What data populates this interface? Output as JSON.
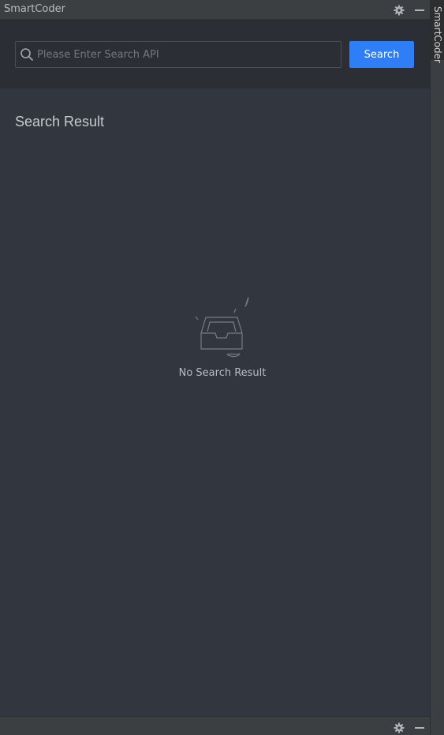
{
  "window": {
    "title": "SmartCoder"
  },
  "side_stripe": {
    "tab_label": "SmartCoder"
  },
  "search": {
    "placeholder": "Please Enter Search API",
    "value": "",
    "button_label": "Search"
  },
  "results": {
    "title": "Search Result",
    "empty_text": "No Search Result"
  },
  "colors": {
    "accent": "#2d7ef7",
    "panel_bg": "#32363e",
    "search_bg": "#2b2e35",
    "chrome_bg": "#3c3f41"
  },
  "icons": {
    "header_settings": "gear-icon",
    "header_minimize": "minimize-icon",
    "search": "search-icon",
    "empty": "empty-inbox-icon",
    "footer_settings": "gear-icon",
    "footer_minimize": "minimize-icon"
  }
}
